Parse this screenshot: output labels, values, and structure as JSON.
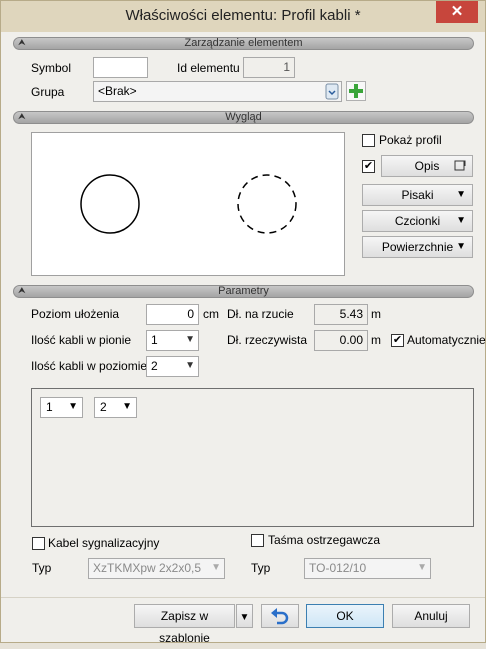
{
  "window": {
    "title": "Właściwości elementu: Profil kabli *",
    "close_glyph": "✕"
  },
  "sections": {
    "management": "Zarządzanie elementem",
    "appearance": "Wygląd",
    "parameters": "Parametry"
  },
  "management": {
    "symbol_label": "Symbol",
    "symbol_value": "",
    "id_label": "Id elementu",
    "id_value": "1",
    "group_label": "Grupa",
    "group_value": "<Brak>"
  },
  "appearance": {
    "show_profile_label": "Pokaż profil",
    "show_profile_checked": false,
    "description_checked": true,
    "description_button": "Opis",
    "pens_button": "Pisaki",
    "fonts_button": "Czcionki",
    "surfaces_button": "Powierzchnie"
  },
  "parameters": {
    "laying_level_label": "Poziom ułożenia",
    "laying_level_value": "0",
    "laying_level_unit": "cm",
    "projection_length_label": "Dł. na rzucie",
    "projection_length_value": "5.43",
    "projection_length_unit": "m",
    "vertical_cables_label": "Ilość kabli w pionie",
    "vertical_cables_value": "1",
    "real_length_label": "Dł. rzeczywista",
    "real_length_value": "0.00",
    "real_length_unit": "m",
    "automatic_label": "Automatycznie",
    "automatic_checked": true,
    "horizontal_cables_label": "Ilość kabli w poziomie",
    "horizontal_cables_value": "2",
    "grid_combo_1": "1",
    "grid_combo_2": "2"
  },
  "signal_cable": {
    "label": "Kabel sygnalizacyjny",
    "checked": false,
    "type_label": "Typ",
    "type_value": "XzTKMXpw 2x2x0,5"
  },
  "warning_tape": {
    "label": "Taśma ostrzegawcza",
    "checked": false,
    "type_label": "Typ",
    "type_value": "TO-012/10"
  },
  "footer": {
    "save_template_button": "Zapisz w szablonie",
    "ok_button": "OK",
    "cancel_button": "Anuluj"
  },
  "icons": {
    "collapse": "chevron-up-icon",
    "add": "plus-icon",
    "undo": "undo-icon",
    "dropdown": "chevron-down-icon"
  },
  "colors": {
    "title_bar": "#dfd6bd",
    "close_button": "#c7463c",
    "add_green": "#3aa53a",
    "undo_blue": "#2a6fc9",
    "ok_border": "#3c7fb1"
  }
}
